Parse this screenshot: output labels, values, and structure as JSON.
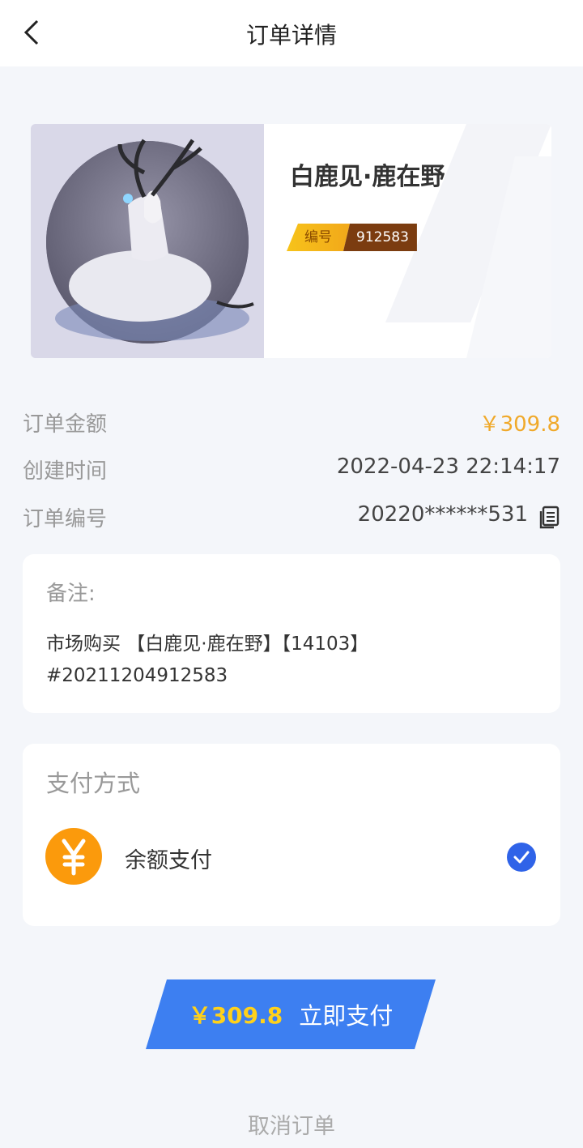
{
  "header": {
    "title": "订单详情",
    "back_icon": "chevron-left-icon"
  },
  "product": {
    "name": "白鹿见·鹿在野",
    "serial_label": "编号",
    "serial_value": "912583"
  },
  "order": {
    "amount_label": "订单金额",
    "amount_value": "￥309.8",
    "created_label": "创建时间",
    "created_value": "2022-04-23 22:14:17",
    "number_label": "订单编号",
    "number_value": "20220******531",
    "copy_icon": "copy-icon"
  },
  "remark": {
    "title": "备注:",
    "line1": "市场购买 【白鹿见·鹿在野】【14103】",
    "line2": "#20211204912583"
  },
  "payment": {
    "title": "支付方式",
    "method": "余额支付",
    "method_icon": "yen-coin-icon",
    "selected_icon": "check-circle-icon"
  },
  "actions": {
    "pay_amount": "￥309.8",
    "pay_label": "立即支付",
    "cancel_label": "取消订单"
  },
  "colors": {
    "accent_blue": "#3d7ff1",
    "price_orange": "#f0a92a",
    "pay_yellow": "#ffd11a",
    "coin_orange": "#fb9a0c"
  }
}
